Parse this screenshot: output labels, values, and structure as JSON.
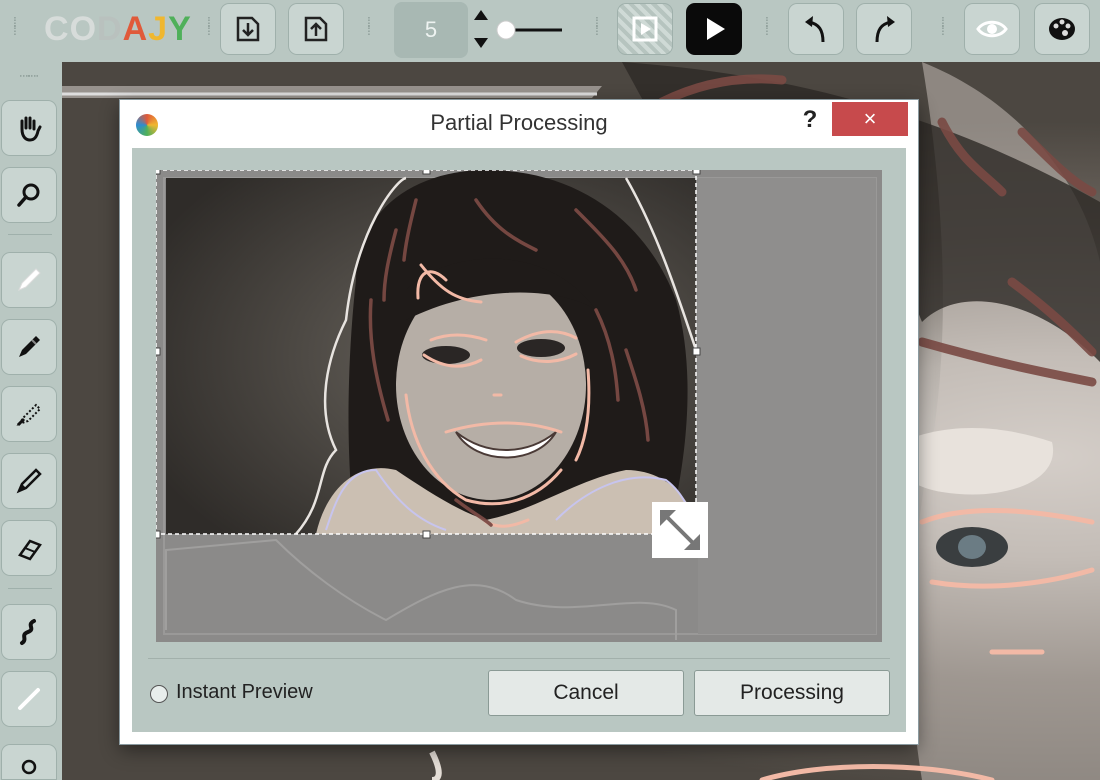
{
  "toolbar": {
    "logo": {
      "l1": "C",
      "l2": "O",
      "l3": "D",
      "l4": "A",
      "l5": "J",
      "l6": "Y"
    },
    "brush_size": "5",
    "icons": [
      "import-icon",
      "export-icon",
      "size-stepper-icon",
      "brush-slider",
      "preview-toggle-icon",
      "play-icon",
      "undo-icon",
      "redo-icon",
      "eye-icon",
      "palette-icon"
    ]
  },
  "sidebar": {
    "tools": [
      "hand-icon",
      "magnifier-icon",
      "white-pencil-icon",
      "marker-icon",
      "dotted-brush-icon",
      "pencil-icon",
      "eraser-icon",
      "squiggle-icon",
      "line-icon"
    ]
  },
  "dialog": {
    "title": "Partial Processing",
    "help": "?",
    "close": "×",
    "instant_preview_label": "Instant Preview",
    "instant_preview_checked": false,
    "cancel_label": "Cancel",
    "processing_label": "Processing"
  },
  "colors": {
    "toolbar_bg": "#b9c7c2",
    "close_red": "#c74a4c",
    "stroke_peach": "#f2b9a6",
    "stroke_brown": "#7a4a44"
  }
}
